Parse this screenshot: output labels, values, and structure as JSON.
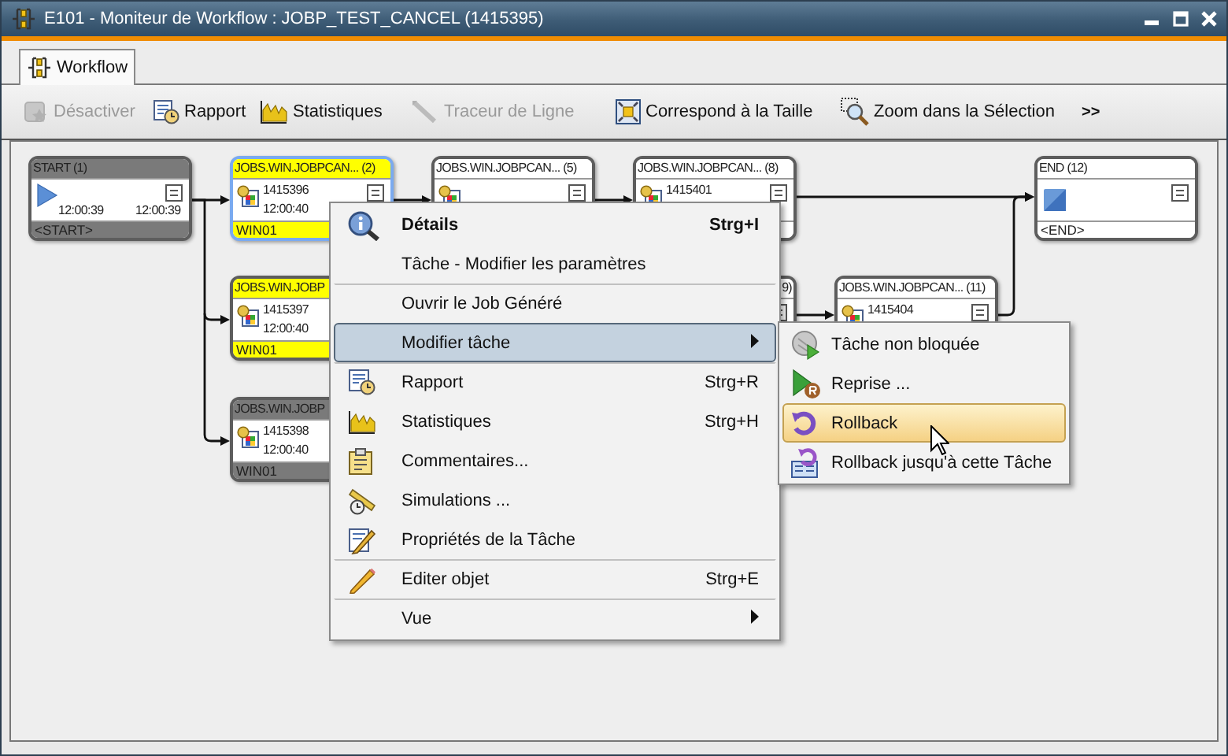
{
  "window": {
    "title": "E101 - Moniteur de Workflow : JOBP_TEST_CANCEL (1415395)"
  },
  "tabs": [
    {
      "label": "Workflow",
      "selected": true
    }
  ],
  "toolbar": {
    "items": [
      {
        "label": "Désactiver",
        "disabled": true
      },
      {
        "label": "Rapport",
        "disabled": false
      },
      {
        "label": "Statistiques",
        "disabled": false
      },
      {
        "label": "Traceur de Ligne",
        "disabled": true
      },
      {
        "label": "Correspond à la Taille",
        "disabled": false
      },
      {
        "label": "Zoom dans la Sélection",
        "disabled": false
      }
    ],
    "overflow": ">>"
  },
  "nodes": [
    {
      "kind": "start",
      "title": "START (1)",
      "color": "#7a7a7a",
      "selected": false,
      "times": [
        "12:00:39",
        "12:00:39"
      ],
      "footer": "<START>"
    },
    {
      "kind": "job",
      "title": "JOBS.WIN.JOBPCAN... (2)",
      "color": "#ffff00",
      "selected": true,
      "run_id": "1415396",
      "time": "12:00:40",
      "footer": "WIN01"
    },
    {
      "kind": "job",
      "title": "JOBS.WIN.JOBPCAN... (5)",
      "color": "#ffffff",
      "selected": false
    },
    {
      "kind": "job",
      "title": "JOBS.WIN.JOBPCAN... (8)",
      "color": "#ffffff",
      "selected": false,
      "run_id": "1415401"
    },
    {
      "kind": "end",
      "title": "END (12)",
      "color": "#ffffff",
      "selected": false,
      "footer": "<END>"
    },
    {
      "kind": "job",
      "title": "JOBS.WIN.JOBP",
      "color": "#ffff00",
      "selected": false,
      "run_id": "1415397",
      "time": "12:00:40",
      "footer": "WIN01"
    },
    {
      "kind": "job",
      "title": "9)",
      "color": "#ffffff",
      "selected": false
    },
    {
      "kind": "job",
      "title": "JOBS.WIN.JOBPCAN... (11)",
      "color": "#ffffff",
      "selected": false,
      "run_id": "1415404"
    },
    {
      "kind": "job",
      "title": "JOBS.WIN.JOBP",
      "color": "#7a7a7a",
      "selected": false,
      "run_id": "1415398",
      "time": "12:00:40",
      "footer": "WIN01"
    }
  ],
  "context_menu": {
    "items": [
      {
        "label": "Détails",
        "shortcut": "Strg+I",
        "default": true,
        "divider": false,
        "submenu": false,
        "selected": false
      },
      {
        "label": "Tâche - Modifier les paramètres",
        "default": false,
        "divider": false,
        "submenu": false,
        "selected": false
      },
      {
        "label": "Ouvrir le Job Généré",
        "default": false,
        "divider": true,
        "submenu": false,
        "selected": false
      },
      {
        "label": "Modifier tâche",
        "default": false,
        "divider": true,
        "submenu": true,
        "selected": true
      },
      {
        "label": "Rapport",
        "shortcut": "Strg+R",
        "default": false,
        "divider": true,
        "submenu": false,
        "selected": false
      },
      {
        "label": "Statistiques",
        "shortcut": "Strg+H",
        "default": false,
        "divider": false,
        "submenu": false,
        "selected": false
      },
      {
        "label": "Commentaires...",
        "default": false,
        "divider": false,
        "submenu": false,
        "selected": false
      },
      {
        "label": "Simulations ...",
        "default": false,
        "divider": false,
        "submenu": false,
        "selected": false
      },
      {
        "label": "Propriétés de la Tâche",
        "default": false,
        "divider": false,
        "submenu": false,
        "selected": false
      },
      {
        "label": "Editer objet",
        "shortcut": "Strg+E",
        "default": false,
        "divider": true,
        "submenu": false,
        "selected": false
      },
      {
        "label": "Vue",
        "default": false,
        "divider": true,
        "submenu": true,
        "selected": false
      }
    ]
  },
  "submenu": {
    "items": [
      {
        "label": "Tâche non bloquée",
        "selected": false
      },
      {
        "label": "Reprise ...",
        "selected": false
      },
      {
        "label": "Rollback",
        "selected": true
      },
      {
        "label": "Rollback jusqu'à cette Tâche",
        "selected": false
      }
    ]
  }
}
